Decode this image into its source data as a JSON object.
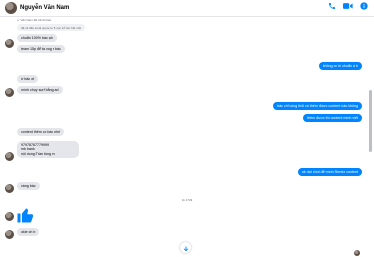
{
  "header": {
    "contact_name": "Nguyễn Văn Nam",
    "accent": "#0084ff"
  },
  "conversation": {
    "reply_note": "↩ Văn Nam đã trả lời bạn",
    "quoted_text": "tất cả đều local quote to 5 cục trở lên hết nhé",
    "msg1": "chuẩn 100% bác ạh",
    "msg2": "team 15p để ta vog r bác",
    "out1": "không cc bí chuẩn à b",
    "msg3": "ừ bác ơi",
    "msg4": "mình chụy sụrf bằng ad",
    "out2": "bác chỉ cùng thôi có thêm được content nào không",
    "out3": "thêm được thì content mình viết",
    "msg5": "content thêm cc bác nhé",
    "msg6_lines": [
      "97978767779999",
      "mb bank",
      "nội dung:Trần tùng rv"
    ],
    "out4": "ok dợi chút để mình Reretz content",
    "msg7": "vàng bác",
    "time_label": "11 1734",
    "msg8": "okie ch b",
    "like_icon": "like-thumb-icon"
  }
}
